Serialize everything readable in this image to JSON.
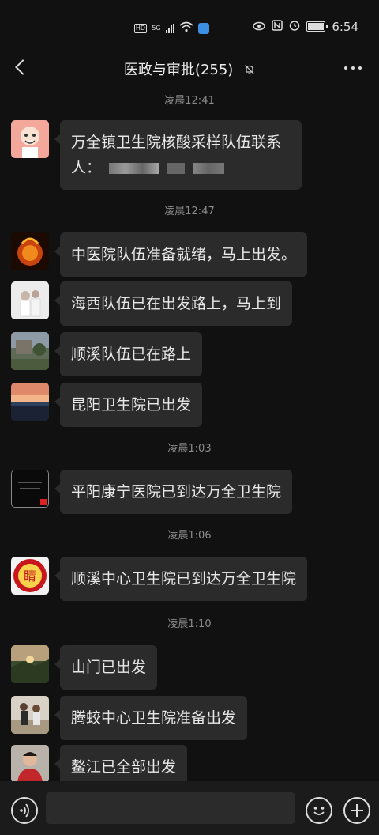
{
  "status_bar": {
    "hd_label": "HD",
    "network_label": "5G",
    "time": "6:54"
  },
  "header": {
    "title": "医政与审批(255)"
  },
  "messages": [
    {
      "time": "凌晨12:41"
    },
    {
      "text_line1": "万全镇卫生院核酸采样队伍联系",
      "text_line2": "人："
    },
    {
      "time": "凌晨12:47"
    },
    {
      "text": "中医院队伍准备就绪，马上出发。"
    },
    {
      "text": "海西队伍已在出发路上，马上到"
    },
    {
      "text": "顺溪队伍已在路上"
    },
    {
      "text": "昆阳卫生院已出发"
    },
    {
      "time": "凌晨1:03"
    },
    {
      "text": "平阳康宁医院已到达万全卫生院"
    },
    {
      "time": "凌晨1:06"
    },
    {
      "text": "顺溪中心卫生院已到达万全卫生院"
    },
    {
      "time": "凌晨1:10"
    },
    {
      "text": "山门已出发"
    },
    {
      "text": "腾蛟中心卫生院准备出发"
    },
    {
      "text": "鳌江已全部出发"
    }
  ],
  "avatar_badges": {
    "hospital_logo_char": "睛"
  },
  "colors": {
    "background": "#111111",
    "bubble": "#2b2b2b",
    "timestamp": "#8a8a8a"
  },
  "icons": [
    "back-icon",
    "mute-bell-icon",
    "more-icon",
    "voice-icon",
    "emoji-icon",
    "plus-icon"
  ]
}
